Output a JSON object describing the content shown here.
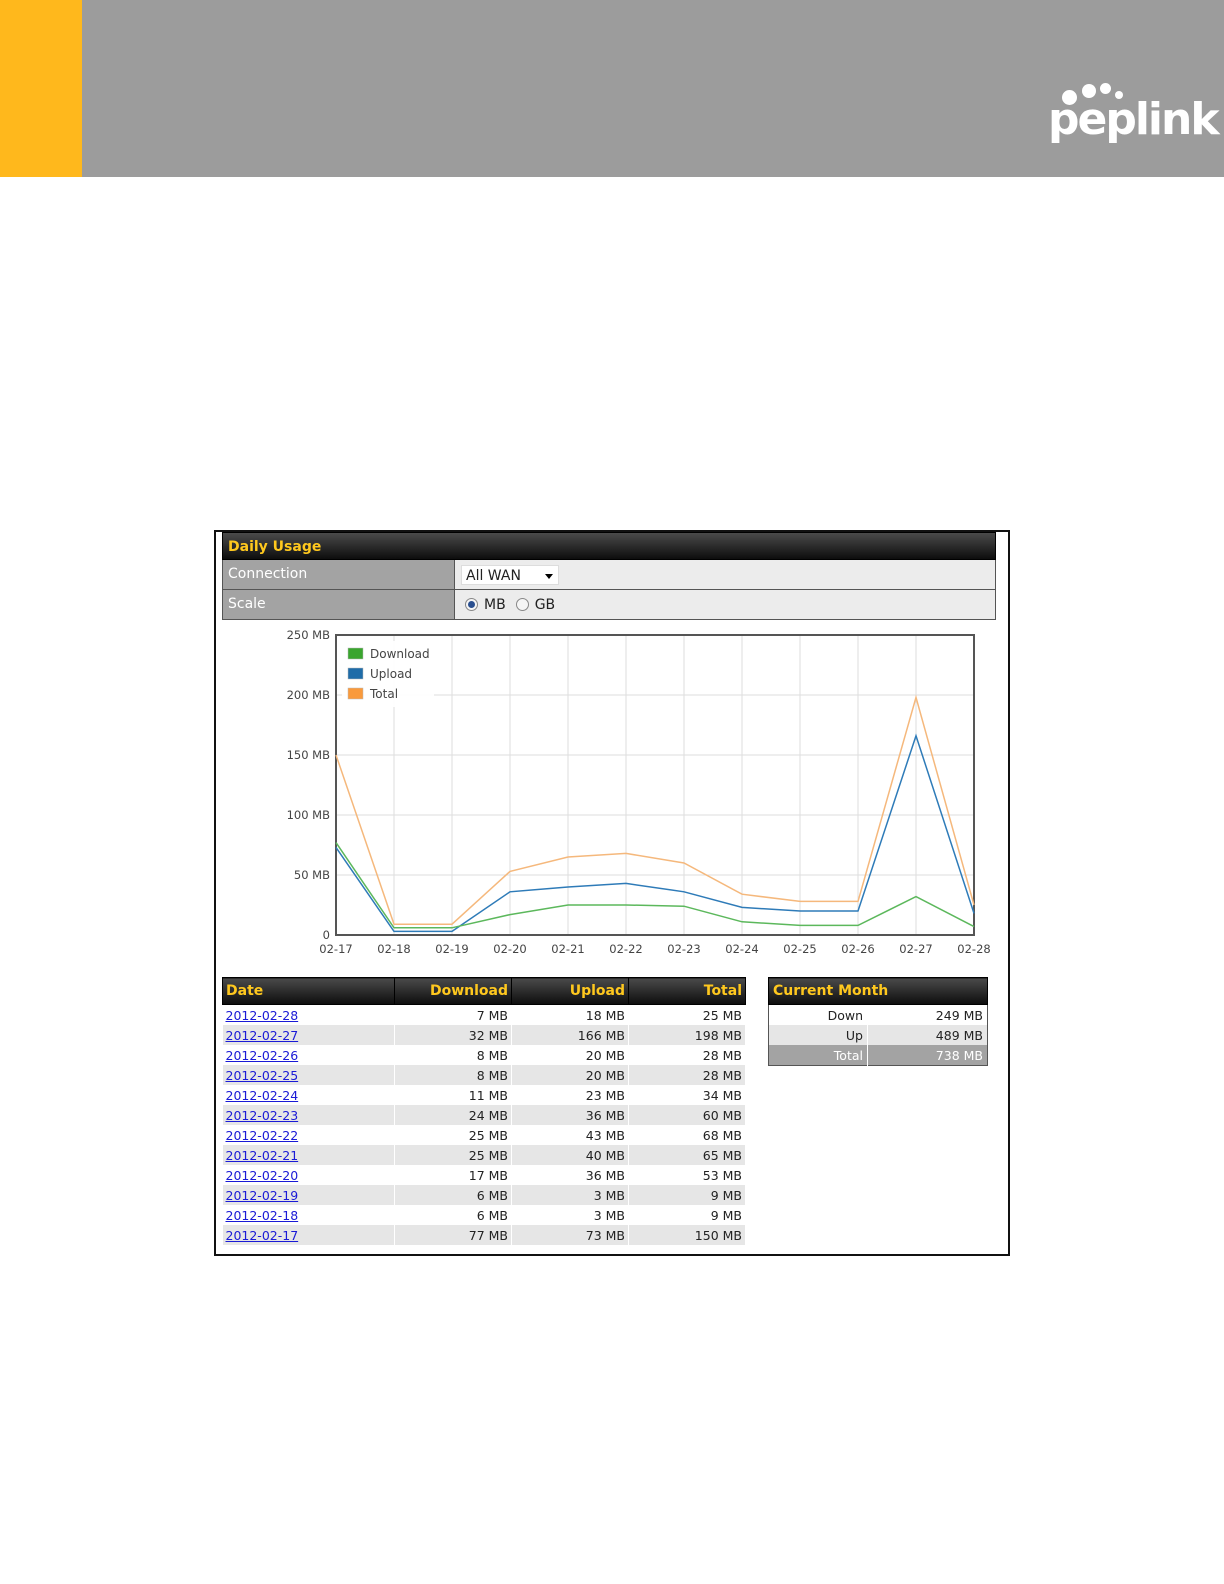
{
  "brand": {
    "logo_text": "peplink",
    "accent_color": "#FFB81C",
    "header_color": "#9c9c9c"
  },
  "panel": {
    "title": "Daily Usage",
    "connection": {
      "label": "Connection",
      "value": "All WAN"
    },
    "scale": {
      "label": "Scale",
      "options": [
        "MB",
        "GB"
      ],
      "selected": "MB"
    }
  },
  "chart_data": {
    "type": "line",
    "categories": [
      "02-17",
      "02-18",
      "02-19",
      "02-20",
      "02-21",
      "02-22",
      "02-23",
      "02-24",
      "02-25",
      "02-26",
      "02-27",
      "02-28"
    ],
    "series": [
      {
        "name": "Download",
        "color": "#5cb85c",
        "values": [
          77,
          6,
          6,
          17,
          25,
          25,
          24,
          11,
          8,
          8,
          32,
          7
        ]
      },
      {
        "name": "Upload",
        "color": "#2e7bb8",
        "values": [
          73,
          3,
          3,
          36,
          40,
          43,
          36,
          23,
          20,
          20,
          166,
          18
        ]
      },
      {
        "name": "Total",
        "color": "#f5b87c",
        "values": [
          150,
          9,
          9,
          53,
          65,
          68,
          60,
          34,
          28,
          28,
          198,
          25
        ]
      }
    ],
    "yticks": [
      "0",
      "50 MB",
      "100 MB",
      "150 MB",
      "200 MB",
      "250 MB"
    ],
    "ylim": [
      0,
      250
    ],
    "grid": true,
    "legend_position": "top-left"
  },
  "table": {
    "headers": [
      "Date",
      "Download",
      "Upload",
      "Total"
    ],
    "rows": [
      [
        "2012-02-28",
        "7 MB",
        "18 MB",
        "25 MB"
      ],
      [
        "2012-02-27",
        "32 MB",
        "166 MB",
        "198 MB"
      ],
      [
        "2012-02-26",
        "8 MB",
        "20 MB",
        "28 MB"
      ],
      [
        "2012-02-25",
        "8 MB",
        "20 MB",
        "28 MB"
      ],
      [
        "2012-02-24",
        "11 MB",
        "23 MB",
        "34 MB"
      ],
      [
        "2012-02-23",
        "24 MB",
        "36 MB",
        "60 MB"
      ],
      [
        "2012-02-22",
        "25 MB",
        "43 MB",
        "68 MB"
      ],
      [
        "2012-02-21",
        "25 MB",
        "40 MB",
        "65 MB"
      ],
      [
        "2012-02-20",
        "17 MB",
        "36 MB",
        "53 MB"
      ],
      [
        "2012-02-19",
        "6 MB",
        "3 MB",
        "9 MB"
      ],
      [
        "2012-02-18",
        "6 MB",
        "3 MB",
        "9 MB"
      ],
      [
        "2012-02-17",
        "77 MB",
        "73 MB",
        "150 MB"
      ]
    ]
  },
  "current_month": {
    "title": "Current Month",
    "rows": [
      {
        "label": "Down",
        "value": "249 MB"
      },
      {
        "label": "Up",
        "value": "489 MB"
      },
      {
        "label": "Total",
        "value": "738 MB"
      }
    ]
  }
}
